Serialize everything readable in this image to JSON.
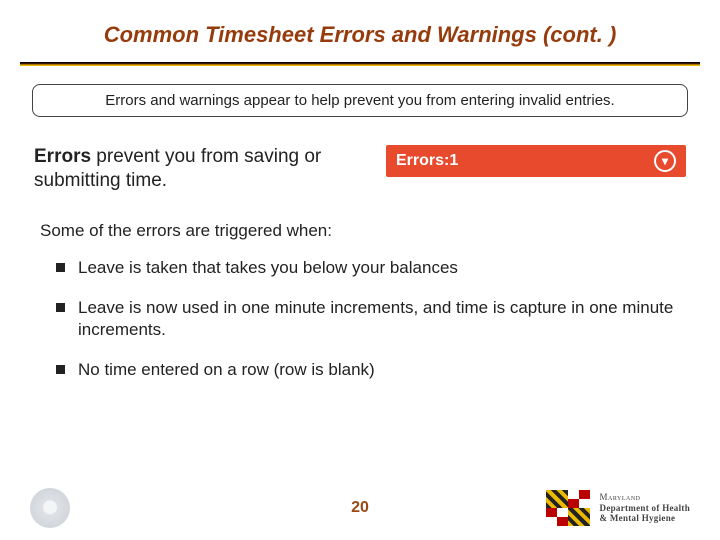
{
  "title": "Common Timesheet Errors and Warnings (cont. )",
  "callout": "Errors and warnings appear to help prevent you from entering invalid entries.",
  "lead": {
    "strong": "Errors",
    "rest": " prevent you from saving or submitting time."
  },
  "error_banner": {
    "label": "Errors:",
    "count": "1"
  },
  "sub_intro": "Some of the errors are triggered when:",
  "bullets": [
    "Leave is taken that takes you below your balances",
    "Leave is now used in one minute increments, and time is capture in one minute increments.",
    "No time entered on a row (row is blank)"
  ],
  "page_number": "20",
  "dept": {
    "line1": "Maryland",
    "line2": "Department of Health",
    "line3": "& Mental Hygiene"
  }
}
